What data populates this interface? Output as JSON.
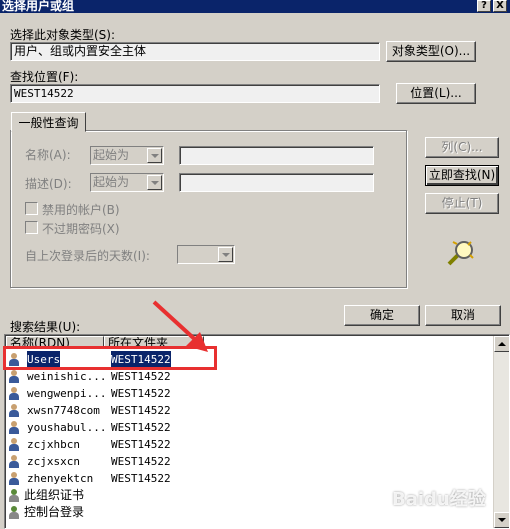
{
  "window": {
    "title": "选择用户或组",
    "help_btn": "?",
    "close_btn": "X"
  },
  "object_type": {
    "label": "选择此对象类型(S):",
    "value": "用户、组或内置安全主体",
    "button": "对象类型(O)..."
  },
  "location": {
    "label": "查找位置(F):",
    "value": "WEST14522",
    "button": "位置(L)..."
  },
  "query": {
    "tab": "一般性查询",
    "name_label": "名称(A):",
    "name_combo": "起始为",
    "desc_label": "描述(D):",
    "desc_combo": "起始为",
    "disabled_accounts": "禁用的帐户(B)",
    "non_expiring_pw": "不过期密码(X)",
    "days_since_login": "自上次登录后的天数(I):"
  },
  "side_buttons": {
    "columns": "列(C)...",
    "find_now": "立即查找(N)",
    "stop": "停止(T)"
  },
  "dialog_buttons": {
    "ok": "确定",
    "cancel": "取消"
  },
  "results": {
    "label": "搜索结果(U):",
    "columns": [
      "名称(RDN)",
      "所在文件夹"
    ],
    "rows": [
      {
        "name": "Users",
        "folder": "WEST14522",
        "icon": "group-icon",
        "selected": true
      },
      {
        "name": "weinishic...",
        "folder": "WEST14522",
        "icon": "user-icon"
      },
      {
        "name": "wengwenpi...",
        "folder": "WEST14522",
        "icon": "user-icon"
      },
      {
        "name": "xwsn7748com",
        "folder": "WEST14522",
        "icon": "user-icon"
      },
      {
        "name": "youshabul...",
        "folder": "WEST14522",
        "icon": "user-icon"
      },
      {
        "name": "zcjxhbcn",
        "folder": "WEST14522",
        "icon": "user-icon"
      },
      {
        "name": "zcjxsxcn",
        "folder": "WEST14522",
        "icon": "user-icon"
      },
      {
        "name": "zhenyektcn",
        "folder": "WEST14522",
        "icon": "user-icon"
      },
      {
        "name": "此组织证书",
        "folder": "",
        "icon": "certificate-icon"
      },
      {
        "name": "控制台登录",
        "folder": "",
        "icon": "console-icon"
      }
    ]
  },
  "watermark": "Baidu经验",
  "colors": {
    "titlebar": "#0a246a",
    "selection": "#0a246a",
    "annotation": "#e83030",
    "face": "#d4d0c8"
  }
}
